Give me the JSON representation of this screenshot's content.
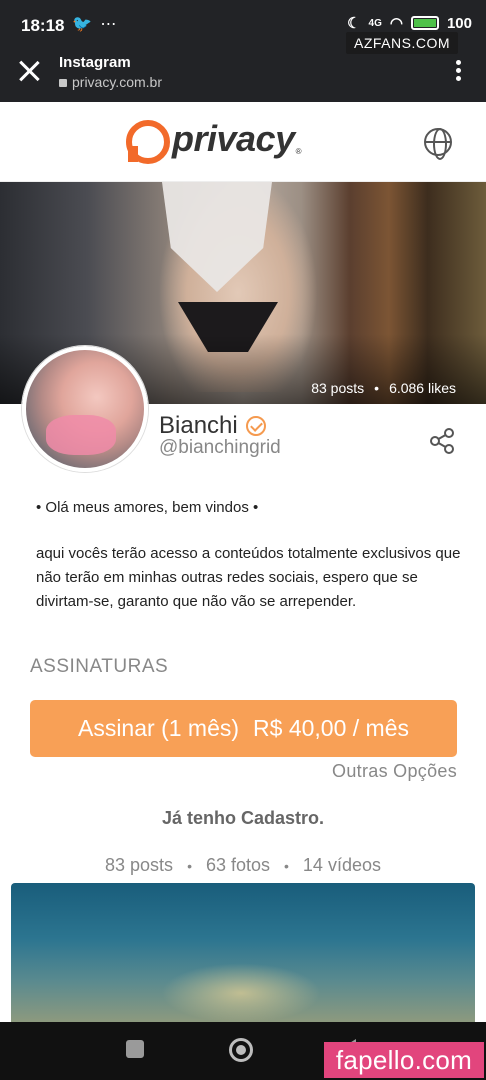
{
  "status_bar": {
    "time": "18:18",
    "left_icons": "🐦 ⋯",
    "battery": "100",
    "network": "4G"
  },
  "browser": {
    "title": "Instagram",
    "url": "privacy.com.br",
    "watermark": "AZFANS.COM"
  },
  "site": {
    "logo_text": "privacy"
  },
  "cover": {
    "posts": "83 posts",
    "likes": "6.086 likes",
    "dot": "•"
  },
  "profile": {
    "name": "Bianchi",
    "handle": "@bianchingrid"
  },
  "bio": {
    "line1": "• Olá meus amores, bem vindos •",
    "line2": "aqui vocês terão acesso a conteúdos totalmente exclusivos que não terão em minhas outras redes sociais, espero que se divirtam-se, garanto que não vão se arrepender."
  },
  "subscriptions": {
    "title": "ASSINATURAS",
    "button_label": "Assinar (1 mês)",
    "button_price": "R$ 40,00 / mês",
    "other_options": "Outras Opções",
    "have_account": "Já tenho Cadastro."
  },
  "media_stats": {
    "posts": "83 posts",
    "photos": "63 fotos",
    "videos": "14 vídeos",
    "dot": "•"
  },
  "watermark_bottom": "fapello.com",
  "colors": {
    "accent": "#f8a056",
    "logo": "#f26a2a",
    "watermark": "#e2457d"
  }
}
